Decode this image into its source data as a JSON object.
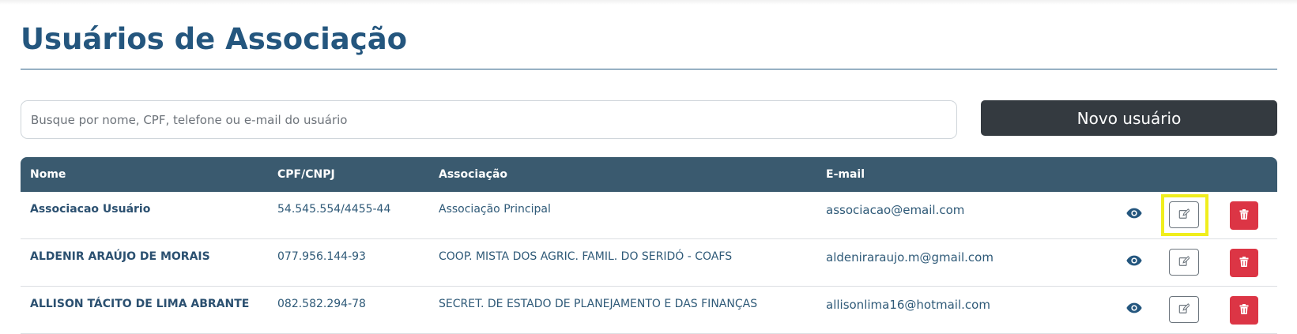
{
  "page": {
    "title": "Usuários de Associação"
  },
  "search": {
    "placeholder": "Busque por nome, CPF, telefone ou e-mail do usuário",
    "value": ""
  },
  "toolbar": {
    "new_user_label": "Novo usuário"
  },
  "table": {
    "columns": [
      "Nome",
      "CPF/CNPJ",
      "Associação",
      "E-mail"
    ],
    "rows": [
      {
        "name": "Associacao Usuário",
        "cpf": "54.545.554/4455-44",
        "association": "Associação Principal",
        "email": "associacao@email.com",
        "highlighted_action": "edit"
      },
      {
        "name": "ALDENIR ARAÚJO DE MORAIS",
        "cpf": "077.956.144-93",
        "association": "COOP. MISTA DOS AGRIC. FAMIL. DO SERIDÓ - COAFS",
        "email": "aldeniraraujo.m@gmail.com"
      },
      {
        "name": "ALLISON TÁCITO DE LIMA ABRANTE",
        "cpf": "082.582.294-78",
        "association": "SECRET. DE ESTADO DE PLANEJAMENTO E DAS FINANÇAS",
        "email": "allisonlima16@hotmail.com"
      }
    ],
    "row_actions": [
      "eye-icon",
      "edit-icon",
      "trash-icon"
    ]
  },
  "colors": {
    "title": "#24567e",
    "header_bg": "#3a5a6f",
    "primary_button": "#343a40",
    "danger": "#dc3545",
    "highlight": "#f0ee1d"
  }
}
